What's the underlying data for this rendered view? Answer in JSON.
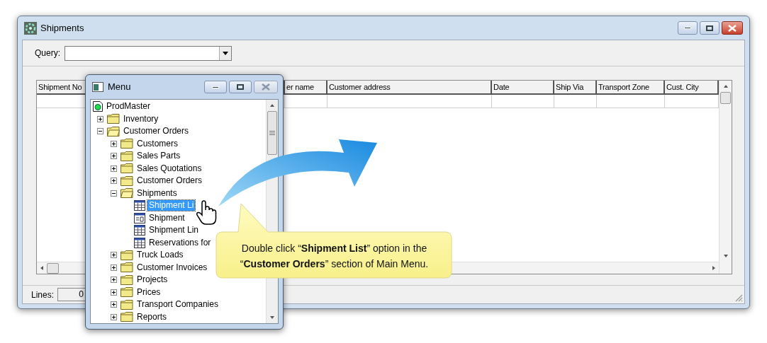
{
  "shipments_window": {
    "title": "Shipments",
    "query": {
      "label": "Query:"
    },
    "grid": {
      "columns": [
        "Shipment No",
        "er name",
        "Customer address",
        "Date",
        "Ship Via",
        "Transport Zone",
        "Cust. City"
      ]
    },
    "status_bar": {
      "label": "Lines:",
      "value": "0"
    }
  },
  "menu_window": {
    "title": "Menu",
    "tree": [
      {
        "label": "ProdMaster",
        "kind": "root",
        "selected": false,
        "children": [
          {
            "label": "Inventory",
            "kind": "folder",
            "expanded": false,
            "selected": false
          },
          {
            "label": "Customer Orders",
            "kind": "folder",
            "expanded": true,
            "selected": false,
            "children": [
              {
                "label": "Customers",
                "kind": "folder",
                "expanded": false,
                "selected": false
              },
              {
                "label": "Sales Parts",
                "kind": "folder",
                "expanded": false,
                "selected": false
              },
              {
                "label": "Sales Quotations",
                "kind": "folder",
                "expanded": false,
                "selected": false
              },
              {
                "label": "Customer Orders",
                "kind": "folder",
                "expanded": false,
                "selected": false
              },
              {
                "label": "Shipments",
                "kind": "folder",
                "expanded": true,
                "selected": false,
                "children": [
                  {
                    "label": "Shipment Li",
                    "kind": "list",
                    "selected": true
                  },
                  {
                    "label": "Shipment",
                    "kind": "form",
                    "selected": false
                  },
                  {
                    "label": "Shipment Lin",
                    "kind": "list",
                    "selected": false
                  },
                  {
                    "label": "Reservations for",
                    "kind": "list",
                    "selected": false
                  }
                ]
              },
              {
                "label": "Truck Loads",
                "kind": "folder",
                "expanded": false,
                "selected": false
              },
              {
                "label": "Customer Invoices",
                "kind": "folder",
                "expanded": false,
                "selected": false
              },
              {
                "label": "Projects",
                "kind": "folder",
                "expanded": false,
                "selected": false
              },
              {
                "label": "Prices",
                "kind": "folder",
                "expanded": false,
                "selected": false
              },
              {
                "label": "Transport Companies",
                "kind": "folder",
                "expanded": false,
                "selected": false
              },
              {
                "label": "Reports",
                "kind": "folder",
                "expanded": false,
                "selected": false
              }
            ]
          }
        ]
      }
    ]
  },
  "callout": {
    "lines": [
      "Double click “**Shipment List**” option in the",
      "“**Customer Orders**” section of Main Menu."
    ]
  }
}
